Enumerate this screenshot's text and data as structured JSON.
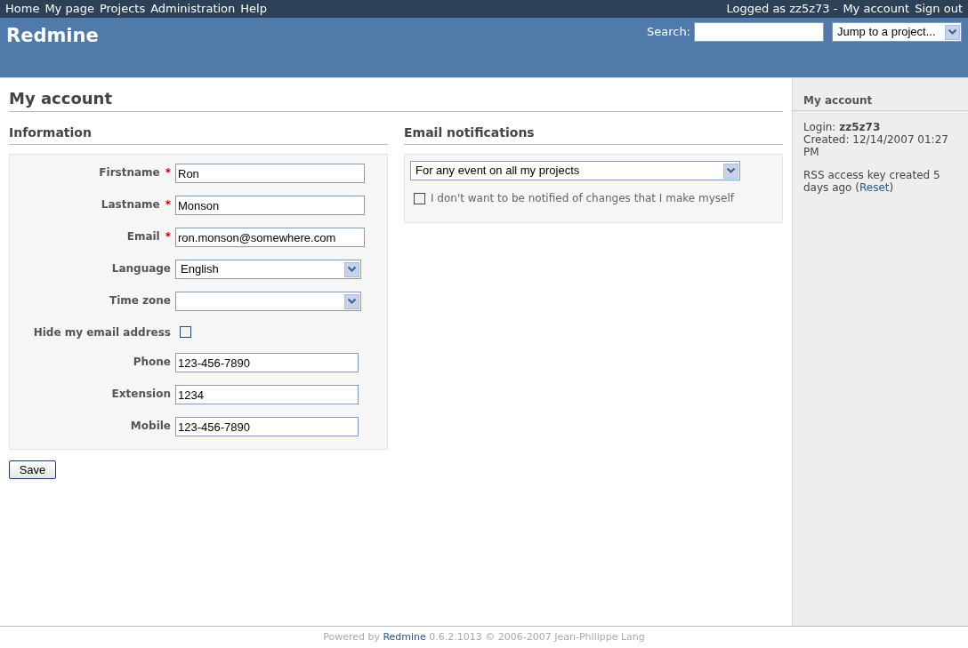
{
  "top_menu": {
    "left": [
      "Home",
      "My page",
      "Projects",
      "Administration",
      "Help"
    ],
    "logged_as": "Logged as zz5z73 -",
    "right": [
      "My account",
      "Sign out"
    ]
  },
  "header": {
    "title": "Redmine",
    "search_label": "Search:",
    "project_jump": "Jump to a project..."
  },
  "page_title": "My account",
  "information": {
    "heading": "Information",
    "fields": [
      {
        "kind": "text",
        "label": "Firstname",
        "mark": "*",
        "value": "Ron"
      },
      {
        "kind": "text",
        "label": "Lastname",
        "mark": "*",
        "value": "Monson"
      },
      {
        "kind": "text",
        "label": "Email",
        "mark": "*",
        "value": "ron.monson@somewhere.com"
      },
      {
        "kind": "select",
        "label": "Language",
        "value": "English"
      },
      {
        "kind": "select",
        "label": "Time zone"
      },
      {
        "kind": "checkbox",
        "label": "Hide my email address",
        "checked": false
      },
      {
        "kind": "text",
        "label": "Phone",
        "value": "123-456-7890"
      },
      {
        "kind": "text",
        "label": "Extension",
        "value": "1234"
      },
      {
        "kind": "text",
        "label": "Mobile",
        "value": "123-456-7890"
      }
    ]
  },
  "save_button": "Save",
  "email_notifications": {
    "heading": "Email notifications",
    "option": "For any event on all my projects",
    "no_self_notified": {
      "label": "I don't want to be notified of changes that I make myself",
      "checked": false
    }
  },
  "sidebar": {
    "heading": "My account",
    "login": "Login: **zz5z73**",
    "created": "Created: 12/14/2007 01:27 PM",
    "rss_before": "RSS access key created 5 days ago (",
    "rss_link": "Reset",
    "rss_after": ")"
  },
  "footer": {
    "before": "Powered by ",
    "link": "Redmine",
    "after": " 0.6.2.1013 © 2006-2007 Jean-Philippe Lang"
  }
}
